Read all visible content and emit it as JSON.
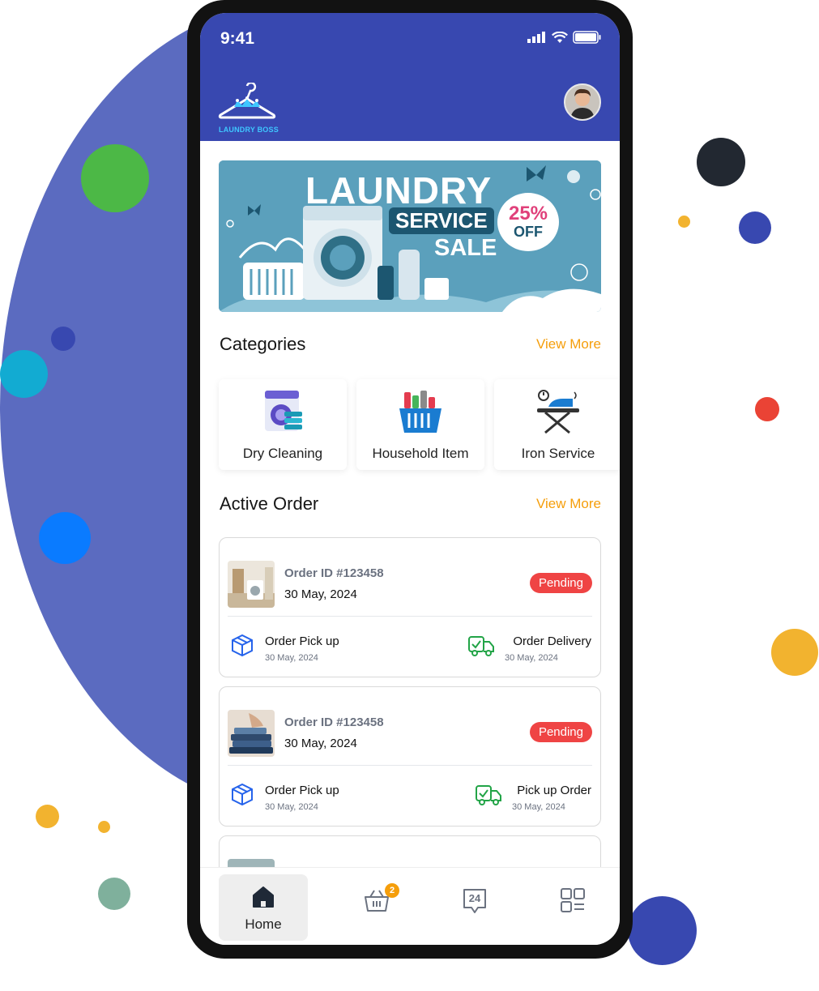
{
  "status_bar": {
    "time": "9:41"
  },
  "brand": {
    "logo_text": "LAUNDRY BOSS"
  },
  "banner": {
    "title": "LAUNDRY",
    "service": "SERVICE",
    "sale": "SALE",
    "offer_percent": "25%",
    "offer_off": "OFF"
  },
  "categories": {
    "title": "Categories",
    "view_more": "View More",
    "items": [
      {
        "label": "Dry Cleaning",
        "icon": "dry-cleaning-icon"
      },
      {
        "label": "Household Item",
        "icon": "household-basket-icon"
      },
      {
        "label": "Iron Service",
        "icon": "iron-icon"
      }
    ]
  },
  "active_order": {
    "title": "Active Order",
    "view_more": "View More",
    "orders": [
      {
        "order_id": "Order ID #123458",
        "date": "30 May, 2024",
        "status": "Pending",
        "pickup_label": "Order Pick up",
        "pickup_date": "30 May, 2024",
        "delivery_label": "Order Delivery",
        "delivery_date": "30 May, 2024"
      },
      {
        "order_id": "Order ID #123458",
        "date": "30 May, 2024",
        "status": "Pending",
        "pickup_label": "Order Pick up",
        "pickup_date": "30 May, 2024",
        "delivery_label": "Pick up Order",
        "delivery_date": "30 May, 2024"
      }
    ]
  },
  "bottom_nav": {
    "home_label": "Home",
    "cart_count": "2",
    "support_label": "24"
  },
  "colors": {
    "primary": "#3848b0",
    "accent": "#f59e0b",
    "pending": "#ef4444",
    "pickup_icon": "#2563eb",
    "delivery_icon": "#22a447"
  }
}
